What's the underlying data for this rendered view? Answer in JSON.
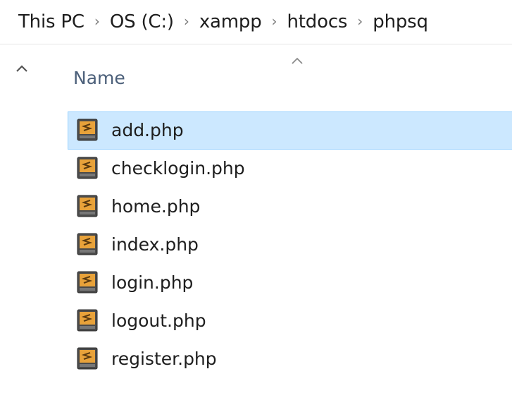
{
  "breadcrumb": {
    "items": [
      "This PC",
      "OS (C:)",
      "xampp",
      "htdocs",
      "phpsq"
    ],
    "separator": "›"
  },
  "column_header": {
    "name_label": "Name",
    "sort": "ascending"
  },
  "files": [
    {
      "name": "add.php",
      "selected": true
    },
    {
      "name": "checklogin.php",
      "selected": false
    },
    {
      "name": "home.php",
      "selected": false
    },
    {
      "name": "index.php",
      "selected": false
    },
    {
      "name": "login.php",
      "selected": false
    },
    {
      "name": "logout.php",
      "selected": false
    },
    {
      "name": "register.php",
      "selected": false
    }
  ],
  "icons": {
    "file_icon": "sublime-text-file-icon",
    "nav_collapse": "chevron-up-icon",
    "sort_indicator": "sort-ascending-icon"
  },
  "colors": {
    "selection_background": "#cce8ff",
    "selection_border": "#99d1ff",
    "header_text": "#4c607a"
  }
}
